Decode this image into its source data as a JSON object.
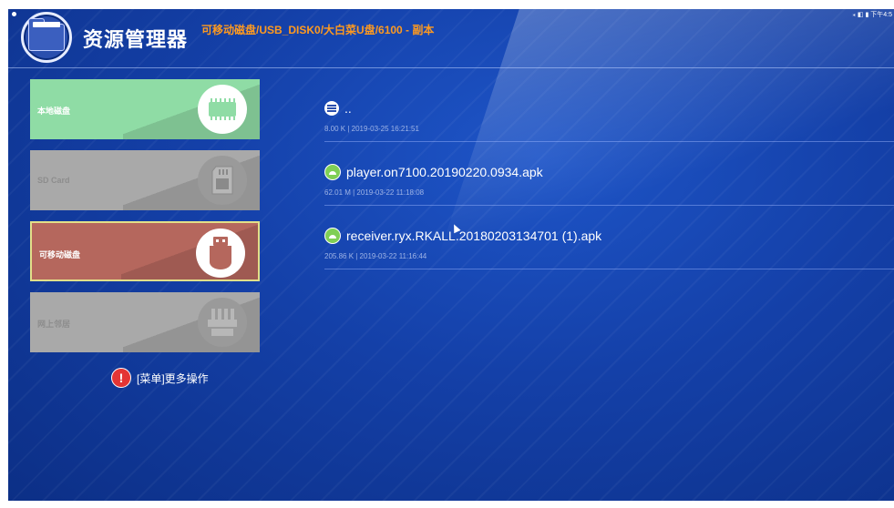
{
  "status_bar": {
    "right_text": "⁎ ◧ ▮ 下午4:5"
  },
  "app": {
    "title": "资源管理器",
    "path": "可移动磁盘/USB_DISK0/大白菜U盘/6100 - 副本"
  },
  "sidebar": {
    "items": [
      {
        "label": "本地磁盘",
        "icon": "memory-chip-icon",
        "state": "normal"
      },
      {
        "label": "SD Card",
        "icon": "sd-card-icon",
        "state": "disabled"
      },
      {
        "label": "可移动磁盘",
        "icon": "usb-drive-icon",
        "state": "selected"
      },
      {
        "label": "网上邻居",
        "icon": "network-drive-icon",
        "state": "disabled"
      }
    ],
    "hint": {
      "icon": "exclamation-icon",
      "text": "[菜单]更多操作"
    }
  },
  "files": [
    {
      "name": "..",
      "meta": "8.00 K | 2019-03-25 16:21:51",
      "icon": "document-icon"
    },
    {
      "name": "player.on7100.20190220.0934.apk",
      "meta": "62.01 M | 2019-03-22 11:18:08",
      "icon": "apk-icon"
    },
    {
      "name": "receiver.ryx.RKALL.20180203134701 (1).apk",
      "meta": "205.86 K | 2019-03-22 11:16:44",
      "icon": "apk-icon"
    }
  ],
  "colors": {
    "background": "#1440a8",
    "accent_path": "#ff9a1f",
    "card_local": "#8fdca5",
    "card_disabled": "#a9a9a9",
    "card_selected": "#b5675d",
    "selected_border": "#e2e089"
  }
}
